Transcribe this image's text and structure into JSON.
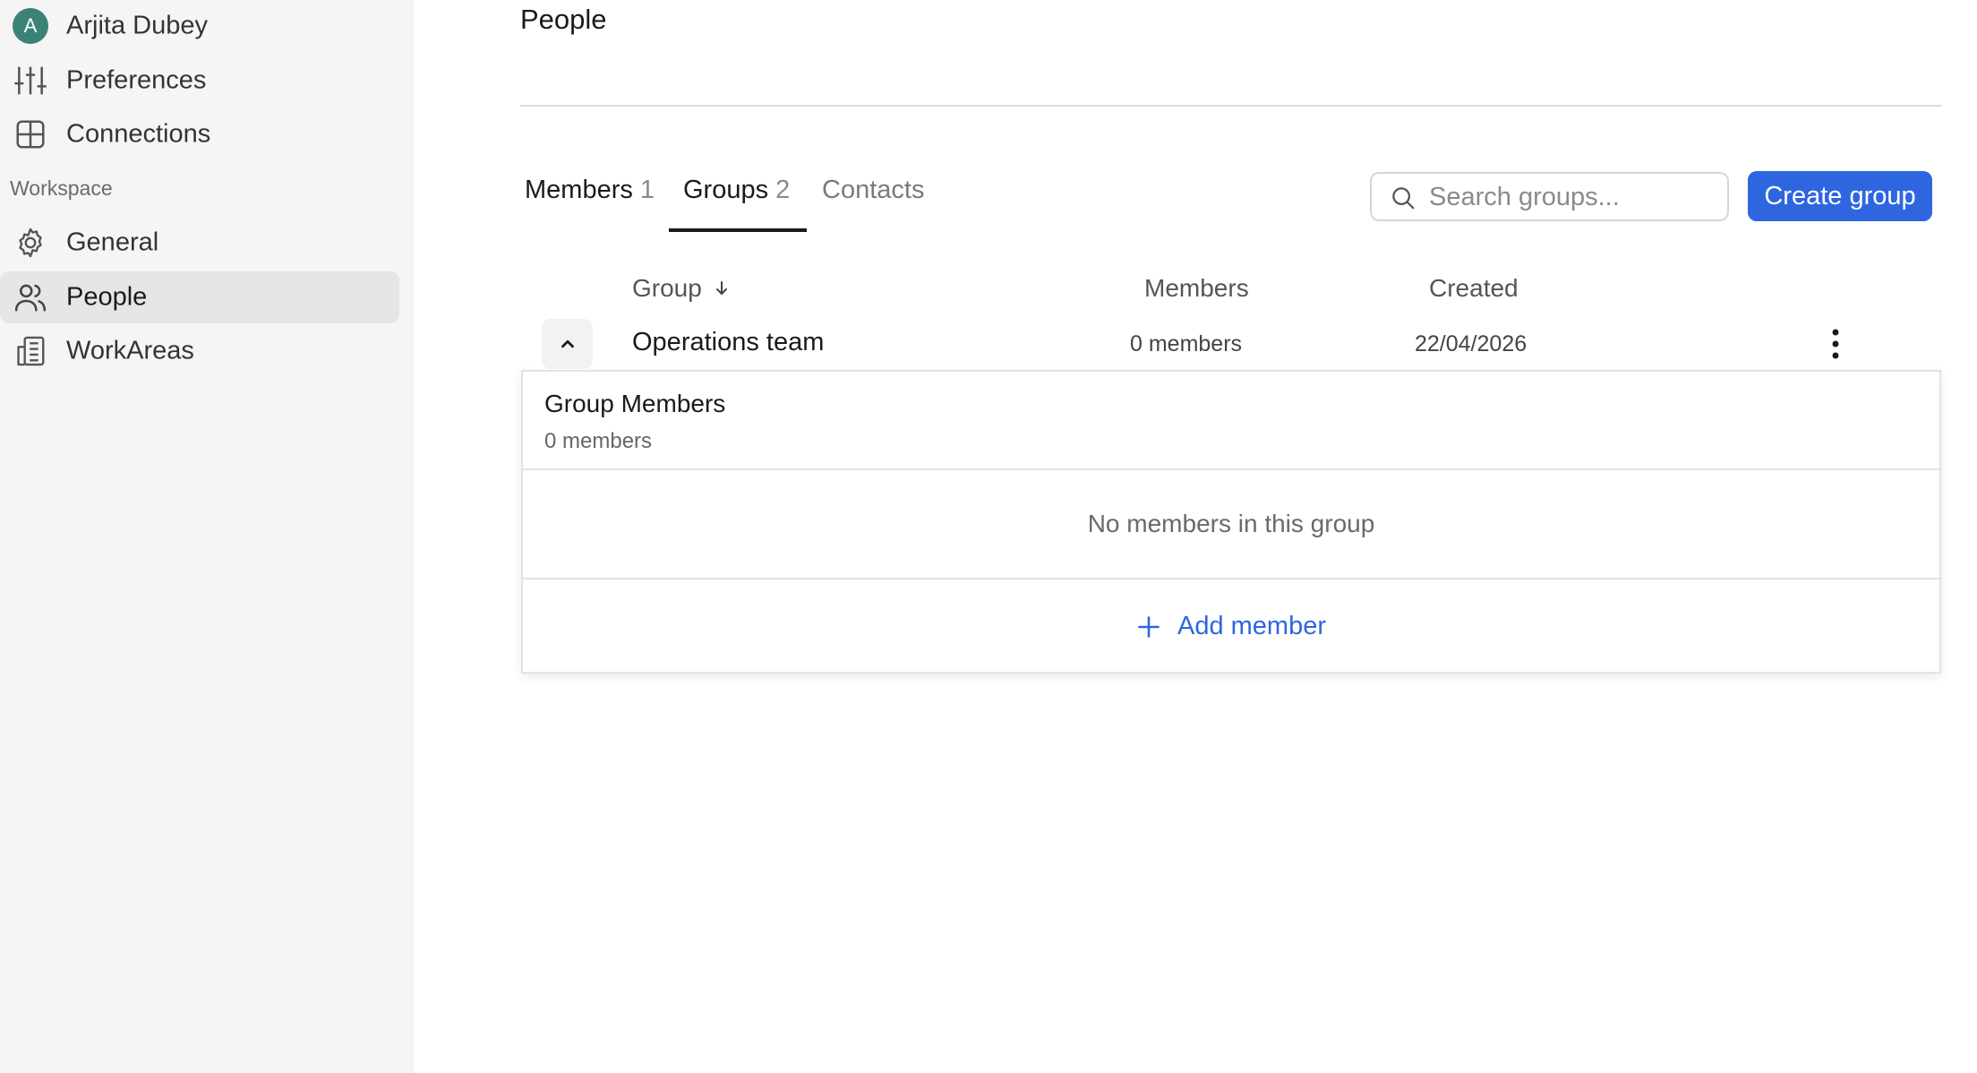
{
  "sidebar": {
    "profile": {
      "initial": "A",
      "name": "Arjita Dubey",
      "avatar_color": "#3b8377"
    },
    "personal_items": [
      {
        "label": "Preferences",
        "icon": "sliders-icon"
      },
      {
        "label": "Connections",
        "icon": "grid-icon"
      }
    ],
    "section_heading": "Workspace",
    "workspace_items": [
      {
        "label": "General",
        "icon": "gear-icon",
        "active": false
      },
      {
        "label": "People",
        "icon": "users-icon",
        "active": true
      },
      {
        "label": "WorkAreas",
        "icon": "building-icon",
        "active": false
      }
    ]
  },
  "main": {
    "title": "People",
    "tabs": [
      {
        "label": "Members",
        "count": "1",
        "active": false
      },
      {
        "label": "Groups",
        "count": "2",
        "active": true
      },
      {
        "label": "Contacts",
        "count": "",
        "active": false
      }
    ],
    "search": {
      "placeholder": "Search groups...",
      "value": ""
    },
    "create_button": "Create group",
    "table": {
      "columns": [
        "Group",
        "Members",
        "Created"
      ],
      "rows": [
        {
          "name": "Operations team",
          "members": "0 members",
          "created": "22/04/2026",
          "expanded": true
        }
      ]
    },
    "expanded_panel": {
      "title": "Group Members",
      "subtitle": "0 members",
      "empty_text": "No members in this group",
      "add_label": "Add member"
    }
  },
  "colors": {
    "accent": "#2e66e0",
    "sidebar_bg": "#f5f5f5",
    "active_item_bg": "#e6e6e6"
  }
}
